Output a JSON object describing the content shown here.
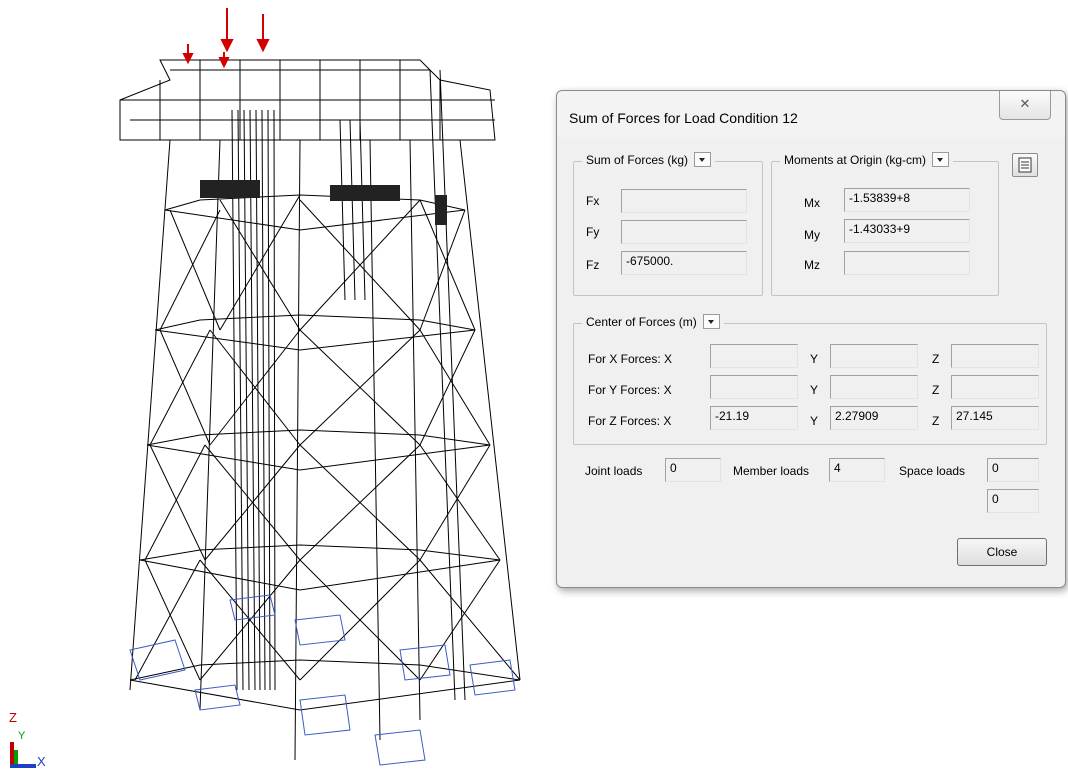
{
  "axis": {
    "z": "Z",
    "y": "Y",
    "x": "X"
  },
  "dialog": {
    "title": "Sum of Forces for Load Condition 12",
    "close_x": "✕",
    "sum_forces": {
      "label": "Sum of Forces (kg)",
      "fx_label": "Fx",
      "fx_value": "",
      "fy_label": "Fy",
      "fy_value": "",
      "fz_label": "Fz",
      "fz_value": "-675000."
    },
    "moments": {
      "label": "Moments at Origin (kg-cm)",
      "mx_label": "Mx",
      "mx_value": "-1.53839+8",
      "my_label": "My",
      "my_value": "-1.43033+9",
      "mz_label": "Mz",
      "mz_value": ""
    },
    "center": {
      "label": "Center of Forces (m)",
      "rows": [
        {
          "label": "For X Forces:  X",
          "x": "",
          "y": "",
          "z": ""
        },
        {
          "label": "For Y Forces:  X",
          "x": "",
          "y": "",
          "z": ""
        },
        {
          "label": "For Z Forces:  X",
          "x": "-21.19",
          "y": "2.27909",
          "z": "27.145"
        }
      ],
      "y_label": "Y",
      "z_label": "Z"
    },
    "loads": {
      "joint_label": "Joint loads",
      "joint_value": "0",
      "member_label": "Member loads",
      "member_value": "4",
      "space_label": "Space loads",
      "space_value": "0",
      "space_value2": "0"
    },
    "close_button": "Close"
  }
}
